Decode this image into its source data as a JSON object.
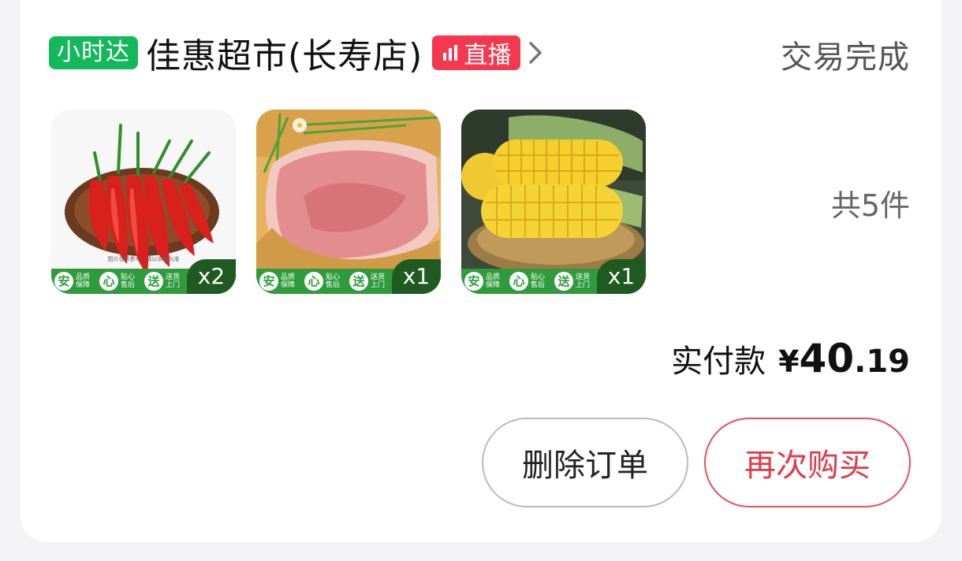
{
  "store": {
    "badge": "小时达",
    "name": "佳惠超市(长寿店)",
    "live_label": "直播"
  },
  "order": {
    "status": "交易完成",
    "total_count": "共5件",
    "paid_label": "实付款",
    "paid_currency": "¥",
    "paid_int": "40",
    "paid_dec": ".19"
  },
  "products": [
    {
      "name": "red-chili-peppers",
      "qty": "x2"
    },
    {
      "name": "pork",
      "qty": "x1"
    },
    {
      "name": "corn",
      "qty": "x1"
    }
  ],
  "strip_seals": [
    "安",
    "心",
    "送"
  ],
  "strip_texts": [
    "品质保障",
    "贴心售后",
    "送货上门"
  ],
  "actions": {
    "delete": "删除订单",
    "rebuy": "再次购买"
  },
  "colors": {
    "hour_badge": "#13b85b",
    "live_badge": "#f5384f",
    "rebuy_accent": "#e23a48"
  }
}
